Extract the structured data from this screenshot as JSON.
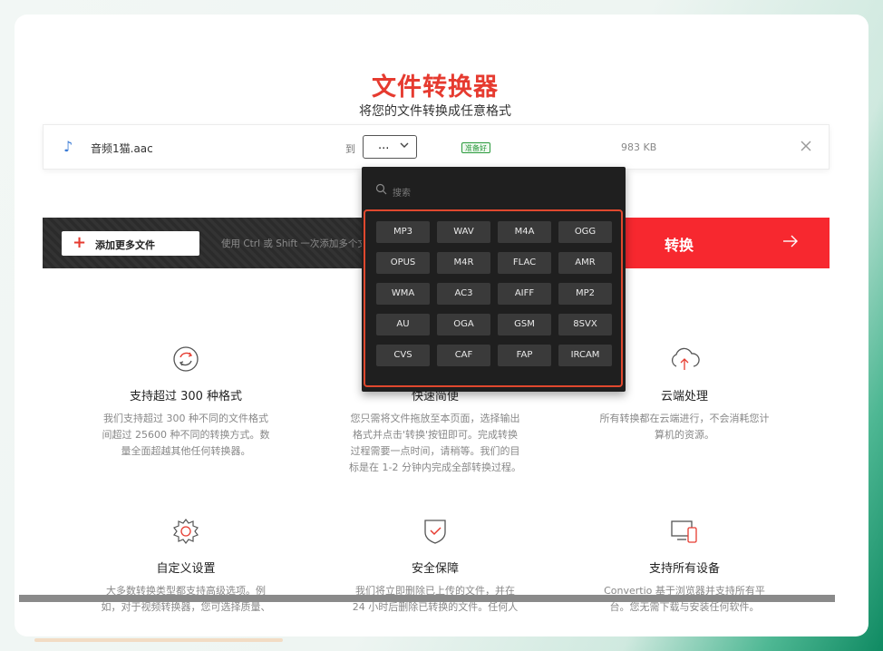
{
  "header": {
    "title": "文件转换器",
    "subtitle": "将您的文件转换成任意格式"
  },
  "file": {
    "name": "音频1猫.aac",
    "to_label": "到",
    "selected_format": "...",
    "status": "准备好",
    "size": "983 KB"
  },
  "actions": {
    "add_files": "添加更多文件",
    "hint": "使用 Ctrl 或 Shift 一次添加多个文件",
    "convert": "转换"
  },
  "dropdown": {
    "search_placeholder": "搜索",
    "formats": [
      "MP3",
      "WAV",
      "M4A",
      "OGG",
      "OPUS",
      "M4R",
      "FLAC",
      "AMR",
      "WMA",
      "AC3",
      "AIFF",
      "MP2",
      "AU",
      "OGA",
      "GSM",
      "8SVX",
      "CVS",
      "CAF",
      "FAP",
      "IRCAM"
    ]
  },
  "features": [
    {
      "icon": "refresh-icon",
      "title": "支持超过 300 种格式",
      "desc_lines": [
        "我们支持超过 300 种不同的文件格式",
        "间超过 25600 种不同的转换方式。数",
        "量全面超越其他任何转换器。"
      ]
    },
    {
      "icon": "speed-icon",
      "title": "快速简便",
      "desc_lines": [
        "您只需将文件拖放至本页面，选择输出",
        "格式并点击'转换'按钮即可。完成转换",
        "过程需要一点时间，请稍等。我们的目",
        "标是在 1-2 分钟内完成全部转换过程。"
      ]
    },
    {
      "icon": "cloud-upload-icon",
      "title": "云端处理",
      "desc_lines": [
        "所有转换都在云端进行，不会消耗您计",
        "算机的资源。"
      ]
    },
    {
      "icon": "gear-icon",
      "title": "自定义设置",
      "desc_lines": [
        "大多数转换类型都支持高级选项。例",
        "如，对于视频转换器，您可选择质量、"
      ]
    },
    {
      "icon": "shield-check-icon",
      "title": "安全保障",
      "desc_lines": [
        "我们将立即删除已上传的文件，并在",
        "24 小时后删除已转换的文件。任何人"
      ]
    },
    {
      "icon": "devices-icon",
      "title": "支持所有设备",
      "desc_lines": [
        "Convertio 基于浏览器并支持所有平",
        "台。您无需下载与安装任何软件。"
      ]
    }
  ]
}
